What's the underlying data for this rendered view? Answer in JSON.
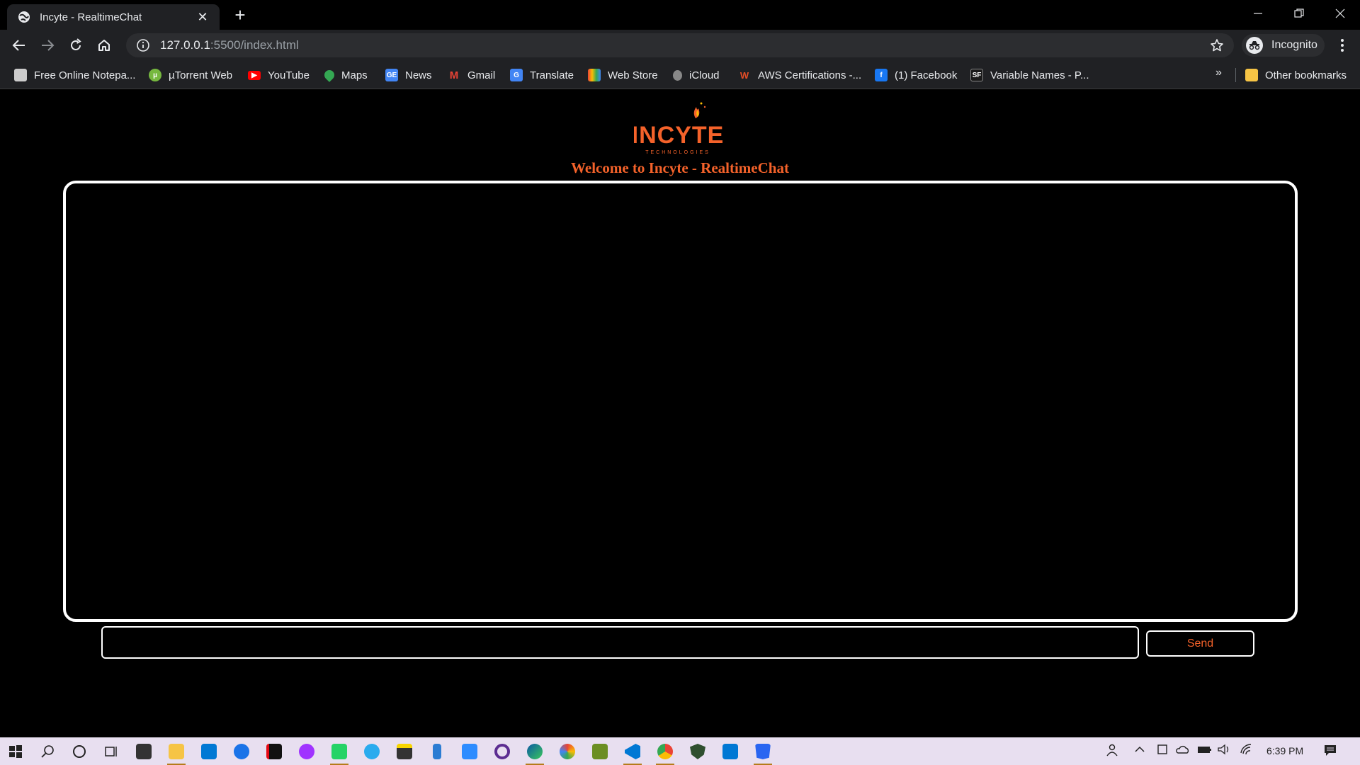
{
  "browser": {
    "tab_title": "Incyte - RealtimeChat",
    "new_tab_label": "+",
    "url_host": "127.0.0.1",
    "url_path": ":5500/index.html",
    "profile_label": "Incognito"
  },
  "bookmarks": {
    "items": [
      {
        "label": "Free Online Notepa...",
        "icon": "notepad-icon",
        "color": "#cccccc"
      },
      {
        "label": "µTorrent Web",
        "icon": "utorrent-icon",
        "color": "#76b83f"
      },
      {
        "label": "YouTube",
        "icon": "youtube-icon",
        "color": "#ff0000"
      },
      {
        "label": "Maps",
        "icon": "maps-icon",
        "color": "#34a853"
      },
      {
        "label": "News",
        "icon": "google-news-icon",
        "color": "#4285f4"
      },
      {
        "label": "Gmail",
        "icon": "gmail-icon",
        "color": "#ea4335"
      },
      {
        "label": "Translate",
        "icon": "translate-icon",
        "color": "#4285f4"
      },
      {
        "label": "Web Store",
        "icon": "web-store-icon",
        "color": "#ea4335"
      },
      {
        "label": "iCloud",
        "icon": "apple-icon",
        "color": "#aaaaaa"
      },
      {
        "label": "AWS Certifications -...",
        "icon": "aws-cert-icon",
        "color": "#e44d26"
      },
      {
        "label": "(1) Facebook",
        "icon": "facebook-icon",
        "color": "#1877f2"
      },
      {
        "label": "Variable Names - P...",
        "icon": "sf-icon",
        "color": "#1a1a1a"
      }
    ],
    "more_label": "»",
    "other_label": "Other bookmarks"
  },
  "page": {
    "logo_text": "INCYTE",
    "logo_subtext": "TECHNOLOGIES",
    "welcome": "Welcome to Incyte - RealtimeChat",
    "message_input_value": "",
    "send_label": "Send",
    "accent_color": "#f4622a"
  },
  "taskbar": {
    "clock": "6:39 PM"
  }
}
